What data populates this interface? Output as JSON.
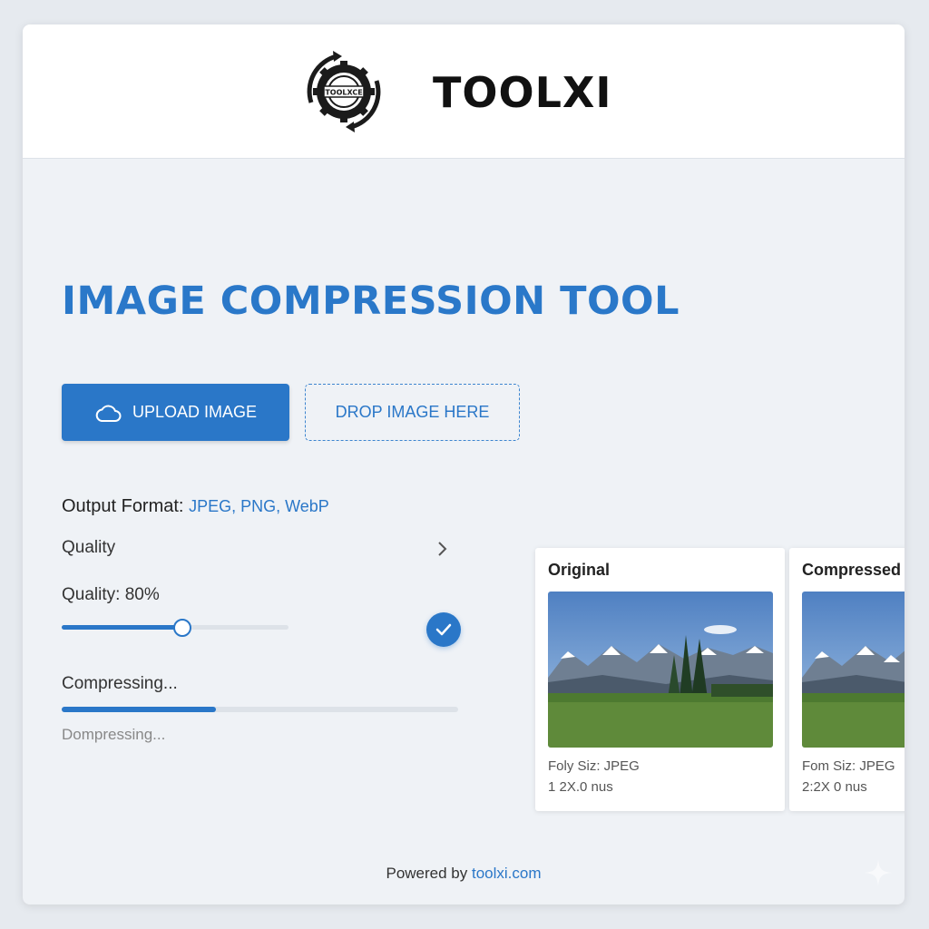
{
  "header": {
    "brand": "TOOLXI",
    "logo_text": "TOOLXCE"
  },
  "main": {
    "title": "IMAGE COMPRESSION TOOL",
    "upload_label": "UPLOAD IMAGE",
    "drop_label": "DROP IMAGE HERE",
    "output_format_label": "Output Format:",
    "output_format_value": "JPEG, PNG, WebP",
    "quality_row_label": "Quality",
    "quality_value_label": "Quality: 80%",
    "quality_slider_fraction": 0.53,
    "compressing_label": "Compressing...",
    "progress_fraction": 0.39,
    "compressing_status": "Dompressing..."
  },
  "preview": {
    "original": {
      "title": "Original",
      "line1": "Foly Siz: JPEG",
      "line2": "1 2X.0 nus"
    },
    "compressed": {
      "title": "Compressed",
      "line1": "Fom Siz: JPEG",
      "line2": "2:2X 0 nus"
    }
  },
  "footer": {
    "prefix": "Powered by ",
    "link": "toolxi.com"
  },
  "colors": {
    "accent": "#2a77c8",
    "title": "#2a78c9",
    "background": "#eff2f6"
  },
  "icons": [
    "gear-logo-icon",
    "cloud-upload-icon",
    "chevron-right-icon",
    "check-icon",
    "sparkle-icon"
  ]
}
